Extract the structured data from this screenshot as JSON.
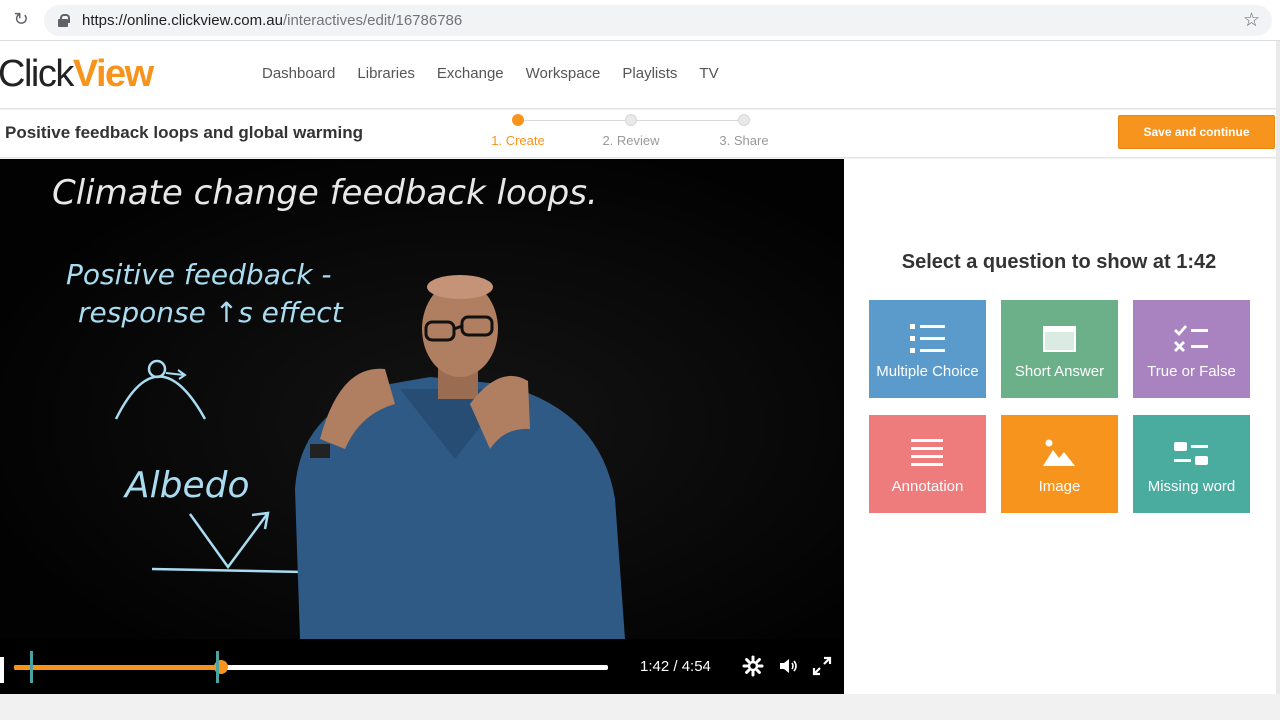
{
  "browser": {
    "url_host": "https://online.clickview.com.au",
    "url_path": "/interactives/edit/16786786"
  },
  "logo": {
    "part1": "Click",
    "part2": "View"
  },
  "nav": [
    "Dashboard",
    "Libraries",
    "Exchange",
    "Workspace",
    "Playlists",
    "TV"
  ],
  "page_title": "Positive feedback loops and global warming",
  "steps": [
    {
      "label": "1. Create",
      "active": true
    },
    {
      "label": "2. Review",
      "active": false
    },
    {
      "label": "3. Share",
      "active": false
    }
  ],
  "save_button": "Save and continue",
  "video": {
    "board_text": [
      "Climate change feedback loops.",
      "Positive feedback -",
      "response ↑s effect",
      "Albedo"
    ],
    "time": "1:42 / 4:54",
    "progress_fraction": 0.348
  },
  "panel": {
    "title": "Select a question to show at 1:42",
    "question_types": [
      {
        "label": "Multiple Choice",
        "color": "#5b9bcb",
        "icon": "list-icon"
      },
      {
        "label": "Short Answer",
        "color": "#6cb08a",
        "icon": "textbox-icon"
      },
      {
        "label": "True or False",
        "color": "#a982c0",
        "icon": "check-cross-icon"
      },
      {
        "label": "Annotation",
        "color": "#ee7c7c",
        "icon": "lines-icon"
      },
      {
        "label": "Image",
        "color": "#f7941d",
        "icon": "image-icon"
      },
      {
        "label": "Missing word",
        "color": "#4aab9f",
        "icon": "blanks-icon"
      }
    ]
  },
  "colors": {
    "brand": "#f7941d",
    "marker": "#4aa3a0"
  }
}
